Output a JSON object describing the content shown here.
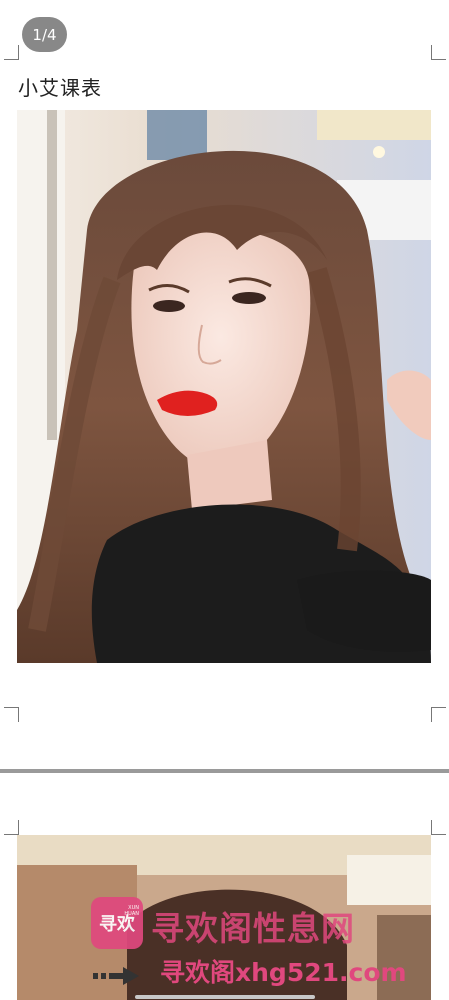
{
  "viewer": {
    "page_counter": "1/4"
  },
  "document": {
    "title": "小艾课表"
  },
  "watermark": {
    "logo_text": "寻欢",
    "logo_small_top": "XUN",
    "logo_small_bottom": "HUAN",
    "site_name": "寻欢阁性息网",
    "site_url": "寻欢阁xhg521.com"
  },
  "colors": {
    "watermark_pink": "#e0487e",
    "counter_bg": "#888888",
    "lip_red": "#e0211f"
  },
  "icons": {
    "arrow": "right-arrow-icon"
  }
}
